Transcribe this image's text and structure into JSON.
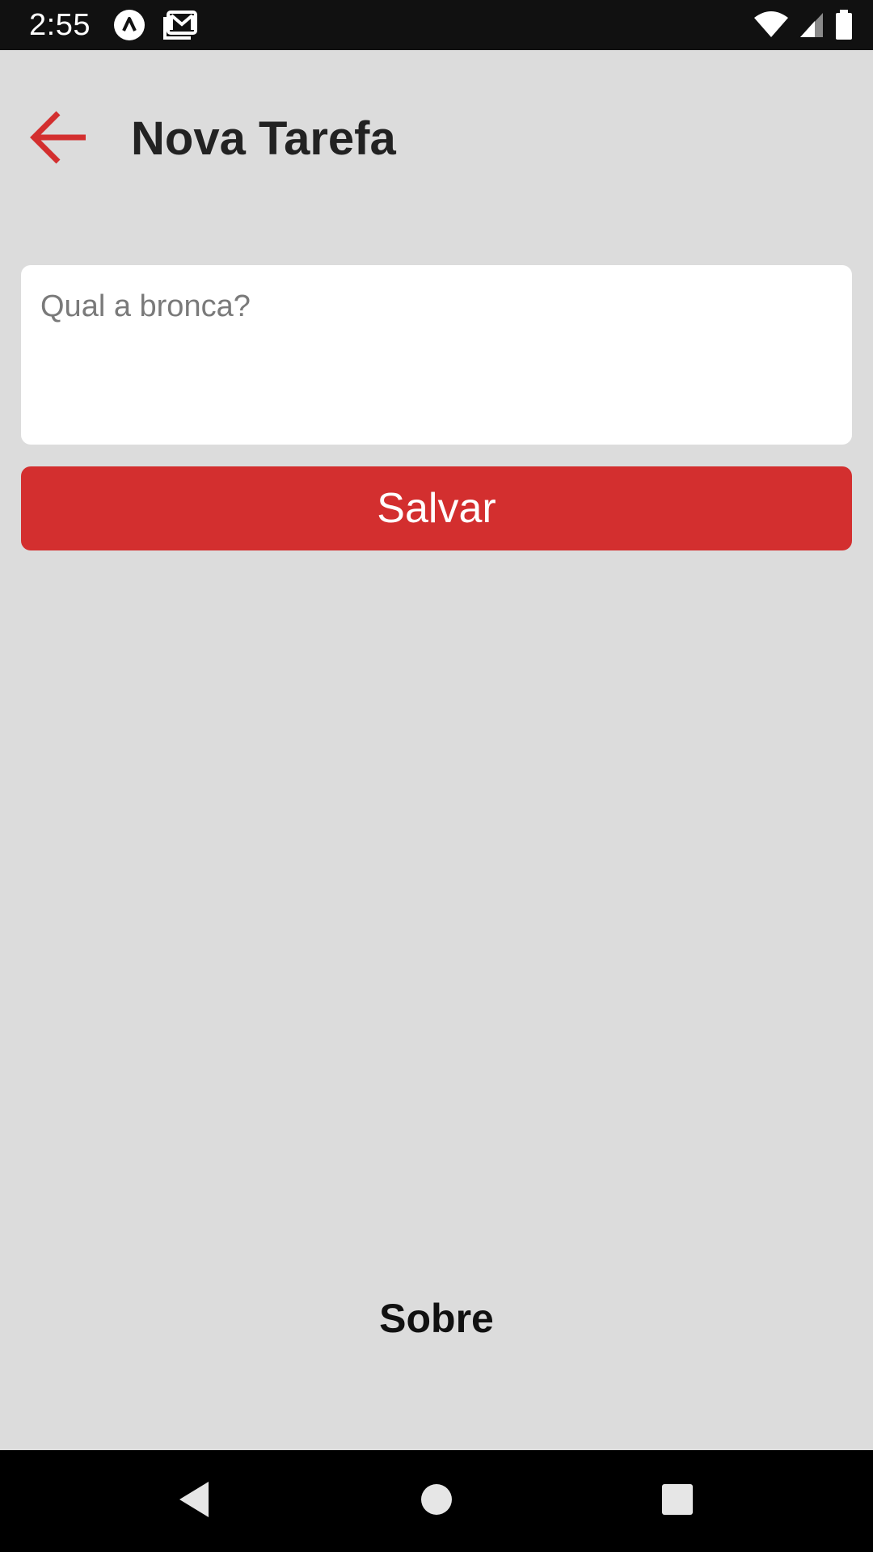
{
  "status_bar": {
    "time": "2:55",
    "left_icons": [
      "app-notification-icon",
      "gmail-icon"
    ],
    "right_icons": [
      "wifi-icon",
      "cell-signal-icon",
      "battery-icon"
    ]
  },
  "header": {
    "back_icon": "arrow-left-icon",
    "title": "Nova Tarefa"
  },
  "form": {
    "task_input": {
      "value": "",
      "placeholder": "Qual a bronca?"
    },
    "save_label": "Salvar"
  },
  "footer": {
    "about_label": "Sobre"
  },
  "nav_bar": {
    "icons": [
      "back-triangle-icon",
      "home-circle-icon",
      "recents-square-icon"
    ]
  },
  "colors": {
    "accent": "#d32f2f",
    "background": "#dcdcdc",
    "card": "#ffffff",
    "title_text": "#222222",
    "status_bar": "#111111",
    "nav_bar": "#000000"
  }
}
